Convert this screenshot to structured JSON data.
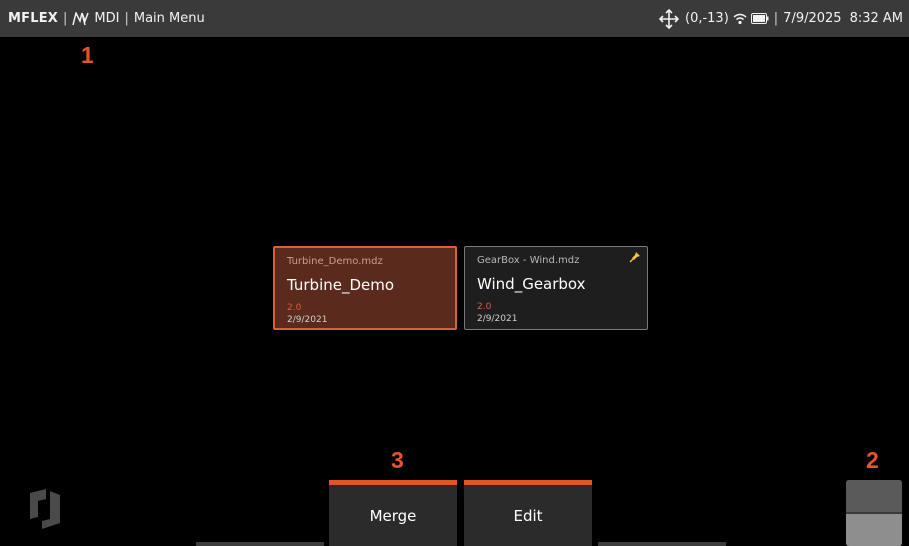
{
  "status_bar": {
    "brand": "MFLEX",
    "logo_icon": "mentor-logo-icon",
    "app": "MDI",
    "screen": "Main Menu",
    "coords": "(0,-13)",
    "date": "7/9/2025",
    "time": "8:32 AM",
    "icons": [
      "move-arrows-icon",
      "wifi-icon",
      "battery-icon"
    ]
  },
  "callouts": {
    "one": "1",
    "two": "2",
    "three": "3"
  },
  "cards": [
    {
      "file": "Turbine_Demo.mdz",
      "title": "Turbine_Demo",
      "version": "2.0",
      "date": "2/9/2021",
      "selected": true
    },
    {
      "file": "GearBox - Wind.mdz",
      "title": "Wind_Gearbox",
      "version": "2.0",
      "date": "2/9/2021",
      "selected": false,
      "icon": "pin-icon"
    }
  ],
  "buttons": {
    "merge": "Merge",
    "edit": "Edit"
  },
  "colors": {
    "accent": "#e0552b",
    "statusbar": "#3a3a3a",
    "background": "#000000"
  }
}
